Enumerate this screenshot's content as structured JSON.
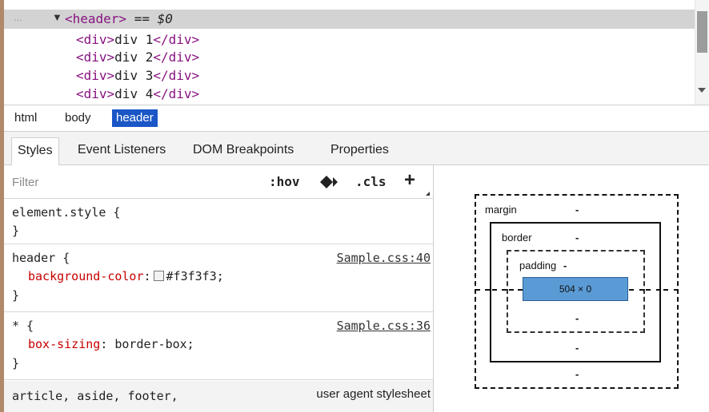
{
  "dom_tree": {
    "ellipsis": "...",
    "expand_arrow": "▼",
    "selected_tag": "<header>",
    "selected_marker": "==",
    "selected_ref": "$0",
    "children": [
      {
        "open": "<div>",
        "text": "div 1",
        "close": "</div>"
      },
      {
        "open": "<div>",
        "text": "div 2",
        "close": "</div>"
      },
      {
        "open": "<div>",
        "text": "div 3",
        "close": "</div>"
      },
      {
        "open": "<div>",
        "text": "div 4",
        "close": "</div>"
      }
    ]
  },
  "breadcrumb": {
    "items": [
      "html",
      "body",
      "header"
    ],
    "selected": "header",
    "selected_color": "#1a56c6"
  },
  "tabs": {
    "items": [
      "Styles",
      "Event Listeners",
      "DOM Breakpoints",
      "Properties"
    ],
    "active": "Styles"
  },
  "styles": {
    "filter_placeholder": "Filter",
    "hov_label": ":hov",
    "cls_label": ".cls",
    "add_label": "+",
    "rules": [
      {
        "selector": "element.style {",
        "close": "}"
      },
      {
        "selector": "header {",
        "source": "Sample.css:40",
        "property": "background-color",
        "value": "#f3f3f3;",
        "swatch_color": "#f3f3f3",
        "close": "}"
      },
      {
        "selector": "* {",
        "source": "Sample.css:36",
        "property": "box-sizing",
        "value": "border-box;",
        "close": "}"
      },
      {
        "selector": "article, aside, footer,",
        "source": "user agent stylesheet"
      }
    ]
  },
  "box_model": {
    "margin_label": "margin",
    "border_label": "border",
    "padding_label": "padding",
    "dash": "-",
    "content_size": "504 × 0",
    "content_color": "#5b9bd5"
  }
}
